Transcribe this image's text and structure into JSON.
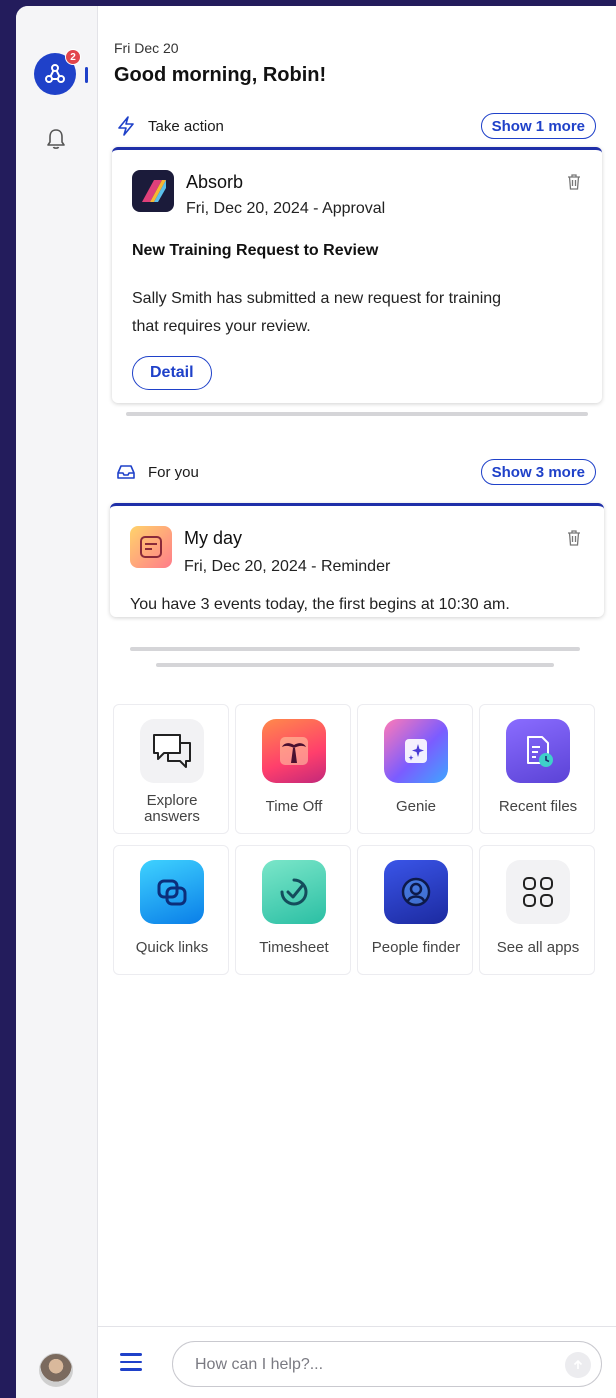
{
  "rail": {
    "logo_icon": "network-logo-icon",
    "notification_count": "2",
    "bell_icon": "bell-icon",
    "avatar": "user-avatar"
  },
  "header": {
    "date": "Fri Dec 20",
    "greeting": "Good morning, Robin!"
  },
  "take_action": {
    "label": "Take action",
    "icon": "lightning-icon",
    "show_more": "Show 1 more",
    "card": {
      "app": "Absorb",
      "meta": "Fri, Dec 20, 2024 - Approval",
      "heading": "New Training Request to Review",
      "body_line1": "Sally Smith has submitted a new request for training",
      "body_line2": "that requires your review.",
      "button": "Detail"
    }
  },
  "for_you": {
    "label": "For you",
    "icon": "inbox-icon",
    "show_more": "Show 3 more",
    "card": {
      "app": "My day",
      "meta": "Fri, Dec 20, 2024 - Reminder",
      "body": "You have 3 events today, the first begins at 10:30 am."
    }
  },
  "apps": [
    {
      "label_line1": "Explore",
      "label_line2": "answers",
      "icon": "chat-bubbles-icon"
    },
    {
      "label_line1": "Time Off",
      "label_line2": "",
      "icon": "palm-tree-icon"
    },
    {
      "label_line1": "Genie",
      "label_line2": "",
      "icon": "sparkle-icon"
    },
    {
      "label_line1": "Recent files",
      "label_line2": "",
      "icon": "file-clock-icon"
    },
    {
      "label_line1": "Quick links",
      "label_line2": "",
      "icon": "link-icon"
    },
    {
      "label_line1": "Timesheet",
      "label_line2": "",
      "icon": "timer-check-icon"
    },
    {
      "label_line1": "People finder",
      "label_line2": "",
      "icon": "person-search-icon"
    },
    {
      "label_line1": "See all apps",
      "label_line2": "",
      "icon": "grid-icon"
    }
  ],
  "composer": {
    "placeholder": "How can I help?..."
  },
  "colors": {
    "accent": "#1f41c9",
    "background": "#231c5c",
    "badge": "#e2454c"
  }
}
